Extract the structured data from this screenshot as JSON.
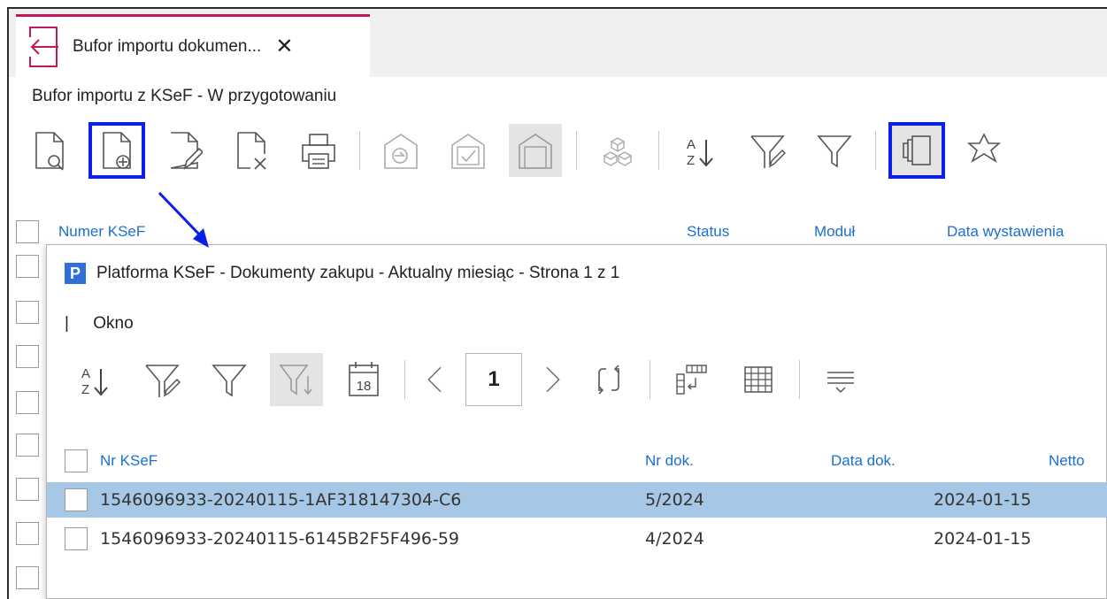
{
  "tab": {
    "title": "Bufor importu dokumen...",
    "close": "✕"
  },
  "subtitle": "Bufor importu z KSeF - W przygotowaniu",
  "main_toolbar": {
    "icons": [
      "preview-document-icon",
      "add-document-icon",
      "edit-document-icon",
      "delete-document-icon",
      "print-icon",
      "import-icon",
      "approve-icon",
      "house-icon",
      "components-icon",
      "sort-icon",
      "filter-clear-icon",
      "filter-icon",
      "copy-pages-icon",
      "star-icon"
    ]
  },
  "grid": {
    "columns": [
      "Numer KSeF",
      "Status",
      "Moduł",
      "Data wystawienia"
    ]
  },
  "dialog": {
    "logo": "P",
    "title": "Platforma KSeF - Dokumenty zakupu - Aktualny miesiąc - Strona 1 z 1",
    "menu_bar": "|",
    "menu": "Okno",
    "page_number": "1",
    "calendar_day": "18",
    "columns": [
      "Nr KSeF",
      "Nr dok.",
      "Data dok.",
      "Netto"
    ],
    "rows": [
      {
        "ksef": "1546096933-20240115-1AF318147304-C6",
        "nr": "5/2024",
        "date": "2024-01-15",
        "selected": true
      },
      {
        "ksef": "1546096933-20240115-6145B2F5F496-59",
        "nr": "4/2024",
        "date": "2024-01-15",
        "selected": false
      }
    ]
  },
  "colors": {
    "accent": "#1a6fcf",
    "highlight": "#0a1ee8",
    "tab_top": "#c2185b",
    "selected_row": "#a6c8e6"
  }
}
